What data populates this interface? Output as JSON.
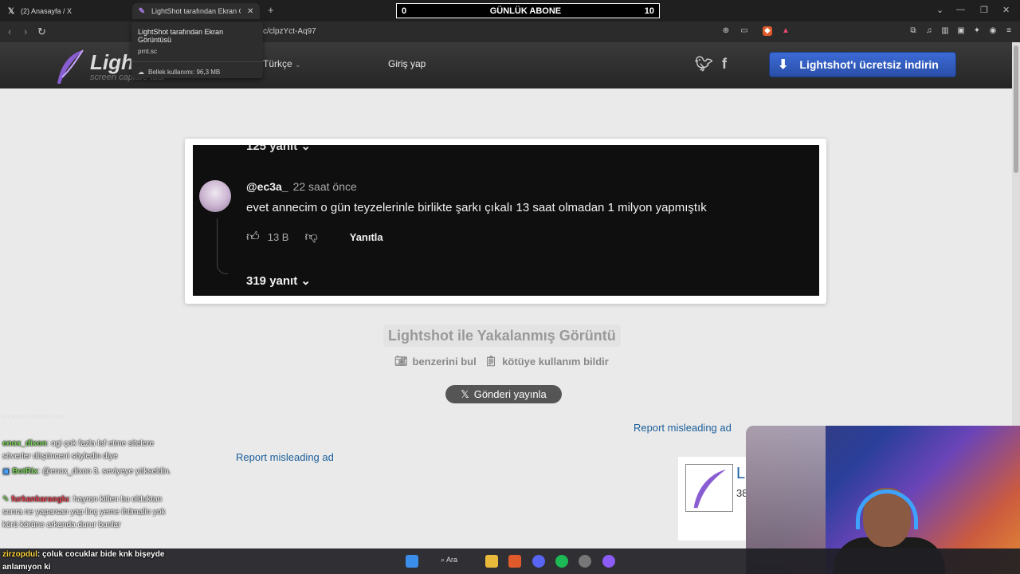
{
  "browser": {
    "tabs": [
      {
        "label": "(2) Anasayfa / X",
        "icon": "x-logo-icon"
      },
      {
        "label": "LightShot tarafından Ekran Görü",
        "icon": "feather-icon",
        "active": true
      }
    ],
    "url": "c/clpzYct-Aq97",
    "new_tab": "+",
    "tooltip": {
      "title": "LightShot tarafından Ekran Görüntüsü",
      "domain": "prnt.sc",
      "memory": "Bellek kullanımı: 96,3 MB"
    }
  },
  "counter": {
    "left": "0",
    "title": "GÜNLÜK ABONE",
    "right": "10"
  },
  "site": {
    "logo": "Lightshot",
    "logo_sub": "screen capture tool",
    "language": "Türkçe",
    "login": "Giriş yap",
    "download": "Lightshot'ı ücretsiz indirin"
  },
  "screenshot": {
    "prev_replies": "125 yanıt",
    "handle": "@ec3a_",
    "time": "22 saat önce",
    "comment": "evet annecim o gün teyzelerinle birlikte şarkı çıkalı 13 saat olmadan 1 milyon yapmıştık",
    "likes": "13 B",
    "reply": "Yanıtla",
    "replies": "319 yanıt"
  },
  "page": {
    "caption": "Lightshot ile Yakalanmış Görüntü",
    "find_similar": "benzerini bul",
    "report_abuse": "kötüye kullanım bildir",
    "post_button": "Gönderi yayınla",
    "report_ad": "Report misleading ad",
    "ad_title": "L",
    "ad_num": "38"
  },
  "chat": [
    {
      "user": "enox_dixon",
      "text": ": ogi çok fazla laf etme sitelere söverler düşünceni söyledin diye",
      "color": "#7bd35a"
    },
    {
      "user": "BotRix",
      "text": ": @enox_dixon 3. seviyeye yükseldin.",
      "color": "#7bd35a"
    },
    {
      "user": "furkankaraoglu",
      "text": ": hayran kitlen bu olduktan sonra ne yaparsan yap linç yeme ihtimalin yok körü körüne arkanda durur bunlar",
      "color": "#e8424f"
    },
    {
      "user": "zirzopdul",
      "text": ": çoluk cocuklar bide knk bişeyde anlamıyon ki",
      "color": "#ffd43b"
    }
  ],
  "taskbar": {
    "search": "Ara"
  },
  "colors": {
    "accent": "#2a4fa8",
    "link": "#1a5e9a",
    "dark_bg": "#0f0f0f"
  }
}
